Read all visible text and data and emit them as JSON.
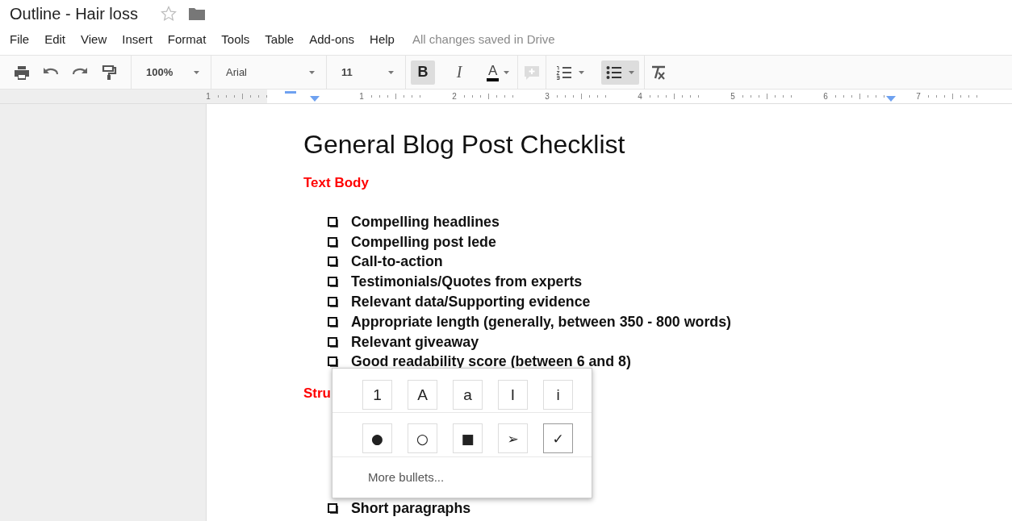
{
  "document_title": "Outline - Hair loss",
  "starred": false,
  "menu": [
    "File",
    "Edit",
    "View",
    "Insert",
    "Format",
    "Tools",
    "Table",
    "Add-ons",
    "Help"
  ],
  "save_status": "All changes saved in Drive",
  "toolbar": {
    "zoom": "100%",
    "font": "Arial",
    "font_size": "11",
    "format_buttons": [
      {
        "kind": "bold",
        "label": "B",
        "active": true
      },
      {
        "kind": "italic",
        "label": "I",
        "active": false
      },
      {
        "kind": "color",
        "label": "A",
        "active": false
      }
    ],
    "numbered_list_active": false,
    "bulleted_list_active": true,
    "comment_disabled": true
  },
  "ruler": {
    "labels": [
      "1",
      "1",
      "2",
      "3",
      "4",
      "5",
      "6",
      "7"
    ]
  },
  "page": {
    "heading": "General Blog Post Checklist",
    "sections": [
      {
        "title": "Text Body",
        "items": [
          "Compelling headlines",
          "Compelling post lede",
          "Call-to-action",
          "Testimonials/Quotes from experts",
          "Relevant data/Supporting evidence",
          "Appropriate length (generally, between 350 - 800 words)",
          "Relevant giveaway",
          "Good readability score (between 6 and 8)"
        ]
      },
      {
        "title": "Stru",
        "items": [
          "Short paragraphs"
        ]
      }
    ]
  },
  "bullet_menu": {
    "numbering": [
      {
        "label": "1",
        "selected": false
      },
      {
        "label": "A",
        "selected": false
      },
      {
        "label": "a",
        "selected": false
      },
      {
        "label": "I",
        "selected": false
      },
      {
        "label": "i",
        "selected": false
      }
    ],
    "bullets": [
      {
        "label": "●",
        "selected": false
      },
      {
        "label": "○",
        "selected": false
      },
      {
        "label": "■",
        "selected": false
      },
      {
        "label": "➢",
        "selected": false
      },
      {
        "label": "✓",
        "selected": true
      }
    ],
    "more": "More bullets..."
  }
}
